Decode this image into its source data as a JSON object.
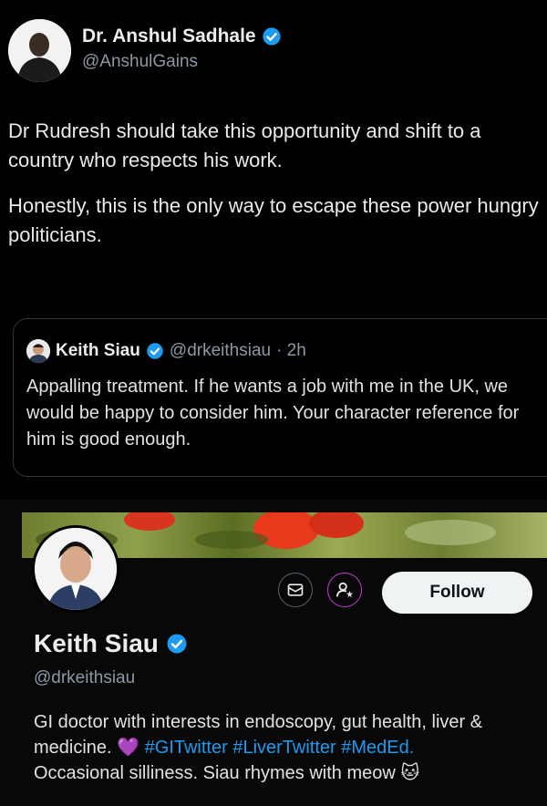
{
  "author": {
    "name": "Dr. Anshul Sadhale",
    "handle": "@AnshulGains"
  },
  "tweet": {
    "paragraph1": "Dr Rudresh should take this opportunity and shift to a country who respects his work.",
    "paragraph2": "Honestly, this is the only way to escape these power hungry politicians."
  },
  "quote": {
    "name": "Keith Siau",
    "handle": "@drkeithsiau",
    "time": "· 2h",
    "text": "Appalling treatment. If he wants a job with me in the UK, we would be happy to consider him. Your character reference for him is good enough."
  },
  "profile": {
    "name": "Keith Siau",
    "handle": "@drkeithsiau",
    "follow_label": "Follow",
    "bio_text": "GI doctor with interests in endoscopy, gut health, liver & medicine.",
    "bio_emoji": "💜",
    "hashtags": "#GITwitter #LiverTwitter #MedEd.",
    "bio_line3": "Occasional silliness. Siau rhymes with meow",
    "bio_end_emoji": "🐱"
  },
  "icons": {
    "verified": "verified-badge-icon",
    "message": "message-icon",
    "subscribe": "subscribe-icon"
  },
  "colors": {
    "background": "#000000",
    "verified_blue": "#1d9bf0",
    "link_blue": "#1d9bf0",
    "follow_bg": "#eff3f4",
    "subscribe_accent": "#c43bd7"
  }
}
